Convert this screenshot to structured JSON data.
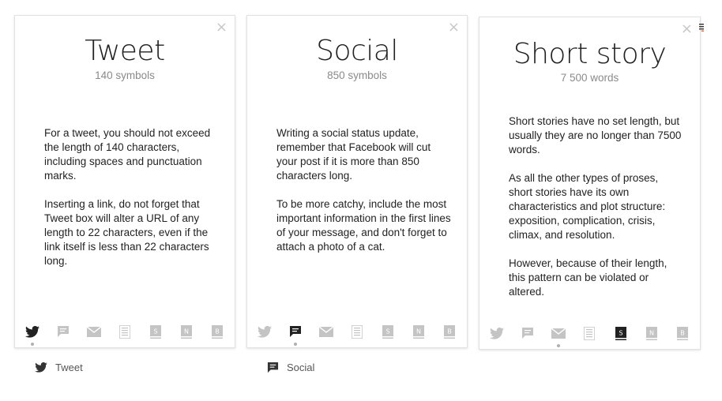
{
  "cards": [
    {
      "title": "Tweet",
      "subtitle": "140 symbols",
      "paragraphs": [
        "For a tweet, you should not exceed the length of 140 characters, including spaces and punctuation marks.",
        "Inserting a link, do not forget that Tweet box will alter a URL of any length to 22 characters, even if the link itself is less than 22 characters long."
      ],
      "close": "×",
      "active_icon": "twitter"
    },
    {
      "title": "Social",
      "subtitle": "850 symbols",
      "paragraphs": [
        "Writing a social status update, remember that Facebook will cut your post if it is more than 850 characters long.",
        "To be more catchy, include the most important information in the first lines of your message, and don't forget to attach a photo of a cat."
      ],
      "close": "×",
      "active_icon": "chat"
    },
    {
      "title": "Short story",
      "subtitle": "7 500 words",
      "paragraphs": [
        "Short stories have no set length, but usually they are no longer than 7500 words.",
        "As all the other types of proses, short stories have its own characteristics and plot structure: exposition, complication, crisis, climax, and resolution.",
        "However, because of their length, this pattern can be violated or altered."
      ],
      "close": "×",
      "active_icon": "story",
      "dot_icon": "mail"
    }
  ],
  "icon_row": [
    "twitter-icon",
    "chat-icon",
    "mail-icon",
    "document-icon",
    "story-icon",
    "novel-icon",
    "book-icon"
  ],
  "icon_letters": {
    "story": "S",
    "novel": "N",
    "book": "B"
  },
  "tabs": [
    {
      "label": "Tweet",
      "icon": "twitter-icon"
    },
    {
      "label": "Social",
      "icon": "chat-icon"
    }
  ],
  "colors": {
    "inactive_icon": "#c4c4c4",
    "active_icon": "#222222",
    "accent_edge": "#e8622c"
  }
}
